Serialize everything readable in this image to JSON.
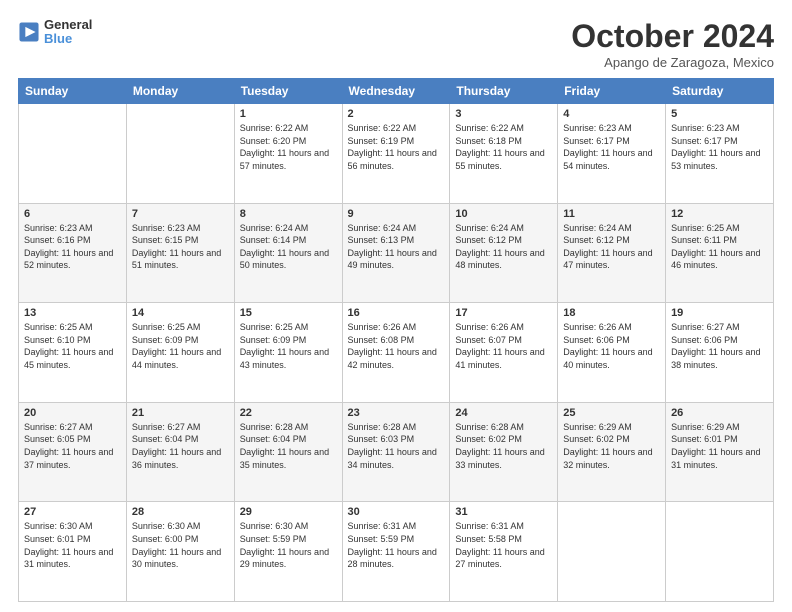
{
  "header": {
    "logo_line1": "General",
    "logo_line2": "Blue",
    "title": "October 2024",
    "location": "Apango de Zaragoza, Mexico"
  },
  "columns": [
    "Sunday",
    "Monday",
    "Tuesday",
    "Wednesday",
    "Thursday",
    "Friday",
    "Saturday"
  ],
  "weeks": [
    [
      {
        "day": "",
        "info": ""
      },
      {
        "day": "",
        "info": ""
      },
      {
        "day": "1",
        "info": "Sunrise: 6:22 AM\nSunset: 6:20 PM\nDaylight: 11 hours and 57 minutes."
      },
      {
        "day": "2",
        "info": "Sunrise: 6:22 AM\nSunset: 6:19 PM\nDaylight: 11 hours and 56 minutes."
      },
      {
        "day": "3",
        "info": "Sunrise: 6:22 AM\nSunset: 6:18 PM\nDaylight: 11 hours and 55 minutes."
      },
      {
        "day": "4",
        "info": "Sunrise: 6:23 AM\nSunset: 6:17 PM\nDaylight: 11 hours and 54 minutes."
      },
      {
        "day": "5",
        "info": "Sunrise: 6:23 AM\nSunset: 6:17 PM\nDaylight: 11 hours and 53 minutes."
      }
    ],
    [
      {
        "day": "6",
        "info": "Sunrise: 6:23 AM\nSunset: 6:16 PM\nDaylight: 11 hours and 52 minutes."
      },
      {
        "day": "7",
        "info": "Sunrise: 6:23 AM\nSunset: 6:15 PM\nDaylight: 11 hours and 51 minutes."
      },
      {
        "day": "8",
        "info": "Sunrise: 6:24 AM\nSunset: 6:14 PM\nDaylight: 11 hours and 50 minutes."
      },
      {
        "day": "9",
        "info": "Sunrise: 6:24 AM\nSunset: 6:13 PM\nDaylight: 11 hours and 49 minutes."
      },
      {
        "day": "10",
        "info": "Sunrise: 6:24 AM\nSunset: 6:12 PM\nDaylight: 11 hours and 48 minutes."
      },
      {
        "day": "11",
        "info": "Sunrise: 6:24 AM\nSunset: 6:12 PM\nDaylight: 11 hours and 47 minutes."
      },
      {
        "day": "12",
        "info": "Sunrise: 6:25 AM\nSunset: 6:11 PM\nDaylight: 11 hours and 46 minutes."
      }
    ],
    [
      {
        "day": "13",
        "info": "Sunrise: 6:25 AM\nSunset: 6:10 PM\nDaylight: 11 hours and 45 minutes."
      },
      {
        "day": "14",
        "info": "Sunrise: 6:25 AM\nSunset: 6:09 PM\nDaylight: 11 hours and 44 minutes."
      },
      {
        "day": "15",
        "info": "Sunrise: 6:25 AM\nSunset: 6:09 PM\nDaylight: 11 hours and 43 minutes."
      },
      {
        "day": "16",
        "info": "Sunrise: 6:26 AM\nSunset: 6:08 PM\nDaylight: 11 hours and 42 minutes."
      },
      {
        "day": "17",
        "info": "Sunrise: 6:26 AM\nSunset: 6:07 PM\nDaylight: 11 hours and 41 minutes."
      },
      {
        "day": "18",
        "info": "Sunrise: 6:26 AM\nSunset: 6:06 PM\nDaylight: 11 hours and 40 minutes."
      },
      {
        "day": "19",
        "info": "Sunrise: 6:27 AM\nSunset: 6:06 PM\nDaylight: 11 hours and 38 minutes."
      }
    ],
    [
      {
        "day": "20",
        "info": "Sunrise: 6:27 AM\nSunset: 6:05 PM\nDaylight: 11 hours and 37 minutes."
      },
      {
        "day": "21",
        "info": "Sunrise: 6:27 AM\nSunset: 6:04 PM\nDaylight: 11 hours and 36 minutes."
      },
      {
        "day": "22",
        "info": "Sunrise: 6:28 AM\nSunset: 6:04 PM\nDaylight: 11 hours and 35 minutes."
      },
      {
        "day": "23",
        "info": "Sunrise: 6:28 AM\nSunset: 6:03 PM\nDaylight: 11 hours and 34 minutes."
      },
      {
        "day": "24",
        "info": "Sunrise: 6:28 AM\nSunset: 6:02 PM\nDaylight: 11 hours and 33 minutes."
      },
      {
        "day": "25",
        "info": "Sunrise: 6:29 AM\nSunset: 6:02 PM\nDaylight: 11 hours and 32 minutes."
      },
      {
        "day": "26",
        "info": "Sunrise: 6:29 AM\nSunset: 6:01 PM\nDaylight: 11 hours and 31 minutes."
      }
    ],
    [
      {
        "day": "27",
        "info": "Sunrise: 6:30 AM\nSunset: 6:01 PM\nDaylight: 11 hours and 31 minutes."
      },
      {
        "day": "28",
        "info": "Sunrise: 6:30 AM\nSunset: 6:00 PM\nDaylight: 11 hours and 30 minutes."
      },
      {
        "day": "29",
        "info": "Sunrise: 6:30 AM\nSunset: 5:59 PM\nDaylight: 11 hours and 29 minutes."
      },
      {
        "day": "30",
        "info": "Sunrise: 6:31 AM\nSunset: 5:59 PM\nDaylight: 11 hours and 28 minutes."
      },
      {
        "day": "31",
        "info": "Sunrise: 6:31 AM\nSunset: 5:58 PM\nDaylight: 11 hours and 27 minutes."
      },
      {
        "day": "",
        "info": ""
      },
      {
        "day": "",
        "info": ""
      }
    ]
  ]
}
